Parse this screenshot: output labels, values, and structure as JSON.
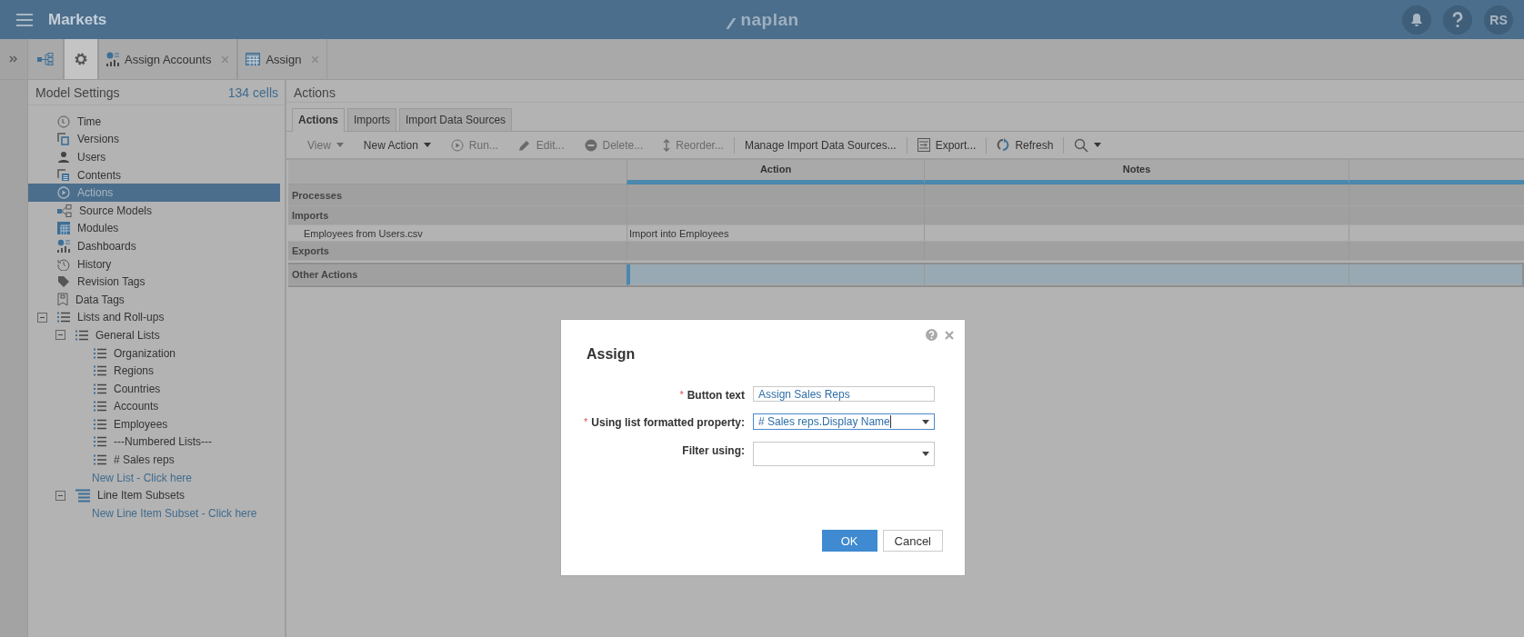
{
  "app_bar": {
    "title": "Markets",
    "logo": "naplan",
    "avatar": "RS"
  },
  "nav_tabs": [
    {
      "kind": "model",
      "selected": false
    },
    {
      "kind": "settings",
      "selected": true
    },
    {
      "kind": "dashboard",
      "label": "Assign Accounts",
      "selected": false
    },
    {
      "kind": "module",
      "label": "Assign",
      "selected": false
    }
  ],
  "sidebar": {
    "title": "Model Settings",
    "count": "134 cells",
    "items": [
      {
        "kind": "time",
        "label": "Time",
        "selected": false
      },
      {
        "kind": "versions",
        "label": "Versions",
        "selected": false
      },
      {
        "kind": "users",
        "label": "Users",
        "selected": false
      },
      {
        "kind": "contents",
        "label": "Contents",
        "selected": false
      },
      {
        "kind": "actions",
        "label": "Actions",
        "selected": true
      },
      {
        "kind": "source",
        "label": "Source Models",
        "selected": false
      },
      {
        "kind": "modules",
        "label": "Modules",
        "selected": false
      },
      {
        "kind": "dashboard",
        "label": "Dashboards",
        "selected": false
      },
      {
        "kind": "history",
        "label": "History",
        "selected": false
      },
      {
        "kind": "tag",
        "label": "Revision Tags",
        "selected": false
      },
      {
        "kind": "datatag",
        "label": "Data Tags",
        "selected": false
      },
      {
        "kind": "list",
        "label": "Lists and Roll-ups",
        "selected": false,
        "expanded": true,
        "children": [
          {
            "kind": "list",
            "label": "General Lists",
            "selected": false,
            "expanded": true,
            "children": [
              {
                "kind": "list",
                "label": "Organization",
                "selected": false
              },
              {
                "kind": "list",
                "label": "Regions",
                "selected": false
              },
              {
                "kind": "list",
                "label": "Countries",
                "selected": false
              },
              {
                "kind": "list",
                "label": "Accounts",
                "selected": false
              },
              {
                "kind": "list",
                "label": "Employees",
                "selected": false
              },
              {
                "kind": "list",
                "label": "---Numbered Lists---",
                "selected": false
              },
              {
                "kind": "list",
                "label": "# Sales reps",
                "selected": false
              },
              {
                "kind": "link",
                "label": "New List - Click here"
              }
            ]
          },
          {
            "kind": "subset",
            "label": "Line Item Subsets",
            "selected": false,
            "expanded": true,
            "children": [
              {
                "kind": "link",
                "label": "New Line Item Subset - Click here"
              }
            ]
          }
        ]
      }
    ]
  },
  "main": {
    "title": "Actions",
    "tabs": [
      {
        "label": "Actions",
        "selected": true
      },
      {
        "label": "Imports",
        "selected": false
      },
      {
        "label": "Import Data Sources",
        "selected": false
      }
    ],
    "toolbar": [
      {
        "kind": "menu",
        "label": "View",
        "disabled": true
      },
      {
        "kind": "menu",
        "label": "New Action",
        "disabled": false
      },
      {
        "kind": "run",
        "label": "Run...",
        "disabled": true
      },
      {
        "kind": "edit",
        "label": "Edit...",
        "disabled": true
      },
      {
        "kind": "delete",
        "label": "Delete...",
        "disabled": true
      },
      {
        "kind": "reorder",
        "label": "Reorder...",
        "disabled": true
      },
      {
        "kind": "separator"
      },
      {
        "kind": "plain",
        "label": "Manage Import Data Sources...",
        "disabled": false
      },
      {
        "kind": "separator"
      },
      {
        "kind": "export",
        "label": "Export...",
        "disabled": false
      },
      {
        "kind": "separator"
      },
      {
        "kind": "refresh",
        "label": "Refresh",
        "disabled": false
      },
      {
        "kind": "separator"
      },
      {
        "kind": "search",
        "disabled": false
      }
    ],
    "table": {
      "columns": [
        "Action",
        "Notes"
      ],
      "rows": [
        {
          "kind": "group",
          "label": "Processes",
          "selected": false
        },
        {
          "kind": "group",
          "label": "Imports",
          "selected": false
        },
        {
          "kind": "item",
          "label": "Employees from Users.csv",
          "action": "Import into Employees",
          "selected": false
        },
        {
          "kind": "group",
          "label": "Exports",
          "selected": false
        },
        {
          "kind": "group",
          "label": "Other Actions",
          "selected": true
        }
      ]
    }
  },
  "dialog": {
    "title": "Assign",
    "fields": [
      {
        "kind": "text",
        "required_mark": "*",
        "label": "Button text",
        "value": "Assign Sales Reps",
        "focused": false
      },
      {
        "kind": "select",
        "required_mark": "*",
        "label": "Using list formatted property:",
        "value": "# Sales reps.Display Name",
        "focused": true
      },
      {
        "kind": "select",
        "label": "Filter using:",
        "focused": false
      }
    ],
    "buttons": [
      {
        "label": "OK",
        "primary": true
      },
      {
        "label": "Cancel",
        "primary": false
      }
    ]
  }
}
